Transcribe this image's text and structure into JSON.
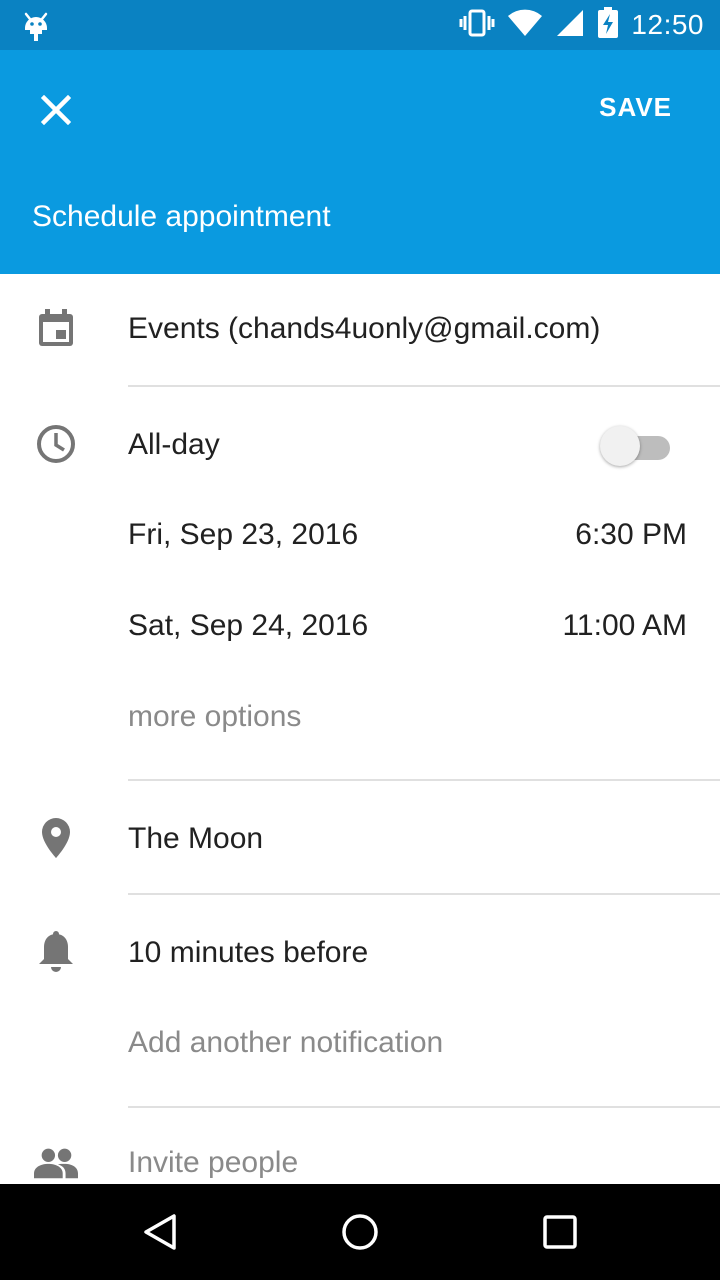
{
  "status_bar": {
    "time": "12:50",
    "icons": [
      "android-notification-icon",
      "vibrate-icon",
      "wifi-icon",
      "cell-signal-icon",
      "battery-charging-icon"
    ]
  },
  "app_bar": {
    "close_icon": "close-icon",
    "save_label": "SAVE",
    "title": "Schedule appointment",
    "background_color": "#0a9ae0"
  },
  "form": {
    "calendar": {
      "icon": "calendar-icon",
      "label": "Events (chands4uonly@gmail.com)"
    },
    "all_day": {
      "icon": "clock-icon",
      "label": "All-day",
      "toggle_on": false
    },
    "start": {
      "date": "Fri, Sep 23, 2016",
      "time": "6:30 PM"
    },
    "end": {
      "date": "Sat, Sep 24, 2016",
      "time": "11:00 AM"
    },
    "more_options": "more options",
    "location": {
      "icon": "location-pin-icon",
      "value": "The Moon"
    },
    "notification": {
      "icon": "bell-icon",
      "value": "10 minutes before",
      "add_label": "Add another notification"
    },
    "invite": {
      "icon": "people-icon",
      "placeholder": "Invite people"
    }
  },
  "nav_bar": {
    "buttons": [
      "back-icon",
      "home-icon",
      "recents-icon"
    ]
  }
}
